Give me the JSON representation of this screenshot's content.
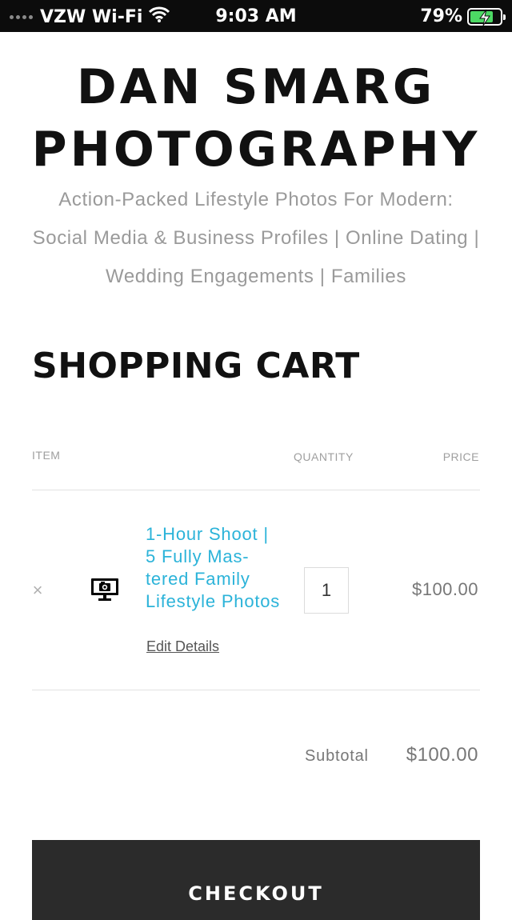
{
  "status_bar": {
    "carrier": "VZW Wi-Fi",
    "time": "9:03 AM",
    "battery": "79%",
    "battery_level": 0.79,
    "battery_color": "#4cd964"
  },
  "header": {
    "title_line1": "DAN SMARG",
    "title_line2": "PHOTOGRAPHY",
    "tagline_line1": "Action-Packed Lifestyle Photos For Modern:",
    "tagline_line2": "Social Media & Business Profiles | Online Dating |",
    "tagline_line3": "Wedding Engagements | Families"
  },
  "cart": {
    "heading": "SHOPPING CART",
    "columns": {
      "item": "ITEM",
      "quantity": "QUANTITY",
      "price": "PRICE"
    },
    "items": [
      {
        "remove_symbol": "×",
        "thumbnail_icon": "monitor-camera-icon",
        "name": "1-Hour Shoot | 5 Fully Mas-tered Family Lifestyle Photos",
        "edit_label": "Edit Details",
        "quantity": "1",
        "price": "$100.00"
      }
    ],
    "subtotal_label": "Subtotal",
    "subtotal_value": "$100.00",
    "checkout_label": "CHECKOUT"
  },
  "colors": {
    "link": "#2bb3d9",
    "button_bg": "#2b2b2b",
    "muted_text": "#9a9a9a"
  }
}
